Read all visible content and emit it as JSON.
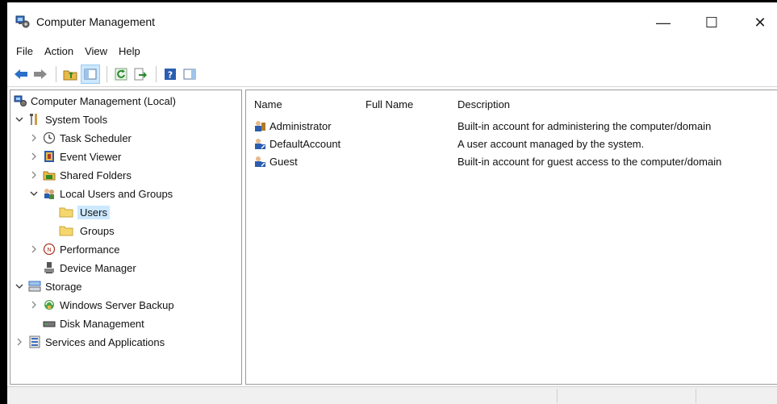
{
  "window": {
    "title": "Computer Management",
    "minimize_glyph": "—",
    "maximize_glyph": "☐",
    "close_glyph": "✕"
  },
  "menubar": {
    "items": [
      "File",
      "Action",
      "View",
      "Help"
    ]
  },
  "toolbar": {
    "icons": [
      "back-arrow-icon",
      "forward-arrow-icon",
      "up-folder-icon",
      "show-hide-tree-icon",
      "refresh-icon",
      "export-list-icon",
      "help-icon",
      "show-hide-action-pane-icon"
    ]
  },
  "tree": {
    "items": [
      {
        "label": "Computer Management (Local)",
        "icon": "computer-management-icon",
        "level": 0,
        "expander": "none"
      },
      {
        "label": "System Tools",
        "icon": "system-tools-icon",
        "level": 0,
        "expander": "expanded"
      },
      {
        "label": "Task Scheduler",
        "icon": "clock-icon",
        "level": 1,
        "expander": "collapsed"
      },
      {
        "label": "Event Viewer",
        "icon": "event-viewer-icon",
        "level": 1,
        "expander": "collapsed"
      },
      {
        "label": "Shared Folders",
        "icon": "shared-folder-icon",
        "level": 1,
        "expander": "collapsed"
      },
      {
        "label": "Local Users and Groups",
        "icon": "users-groups-icon",
        "level": 1,
        "expander": "expanded"
      },
      {
        "label": "Users",
        "icon": "folder-icon",
        "level": 2,
        "expander": "none",
        "selected": true
      },
      {
        "label": "Groups",
        "icon": "folder-icon",
        "level": 2,
        "expander": "none"
      },
      {
        "label": "Performance",
        "icon": "performance-icon",
        "level": 1,
        "expander": "collapsed"
      },
      {
        "label": "Device Manager",
        "icon": "device-manager-icon",
        "level": 1,
        "expander": "none"
      },
      {
        "label": "Storage",
        "icon": "storage-icon",
        "level": 0,
        "expander": "expanded"
      },
      {
        "label": "Windows Server Backup",
        "icon": "backup-icon",
        "level": 1,
        "expander": "collapsed"
      },
      {
        "label": "Disk Management",
        "icon": "disk-icon",
        "level": 1,
        "expander": "none"
      },
      {
        "label": "Services and Applications",
        "icon": "services-icon",
        "level": 0,
        "expander": "collapsed"
      }
    ]
  },
  "list": {
    "columns": [
      "Name",
      "Full Name",
      "Description"
    ],
    "rows": [
      {
        "name": "Administrator",
        "full_name": "",
        "description": "Built-in account for administering the computer/domain",
        "icon": "admin-user-icon"
      },
      {
        "name": "DefaultAccount",
        "full_name": "",
        "description": "A user account managed by the system.",
        "icon": "disabled-user-icon"
      },
      {
        "name": "Guest",
        "full_name": "",
        "description": "Built-in account for guest access to the computer/domain",
        "icon": "disabled-user-icon"
      }
    ]
  },
  "colors": {
    "selection": "#cce8ff",
    "folder": "#f5d76e",
    "accent_blue": "#2a6fc9"
  }
}
